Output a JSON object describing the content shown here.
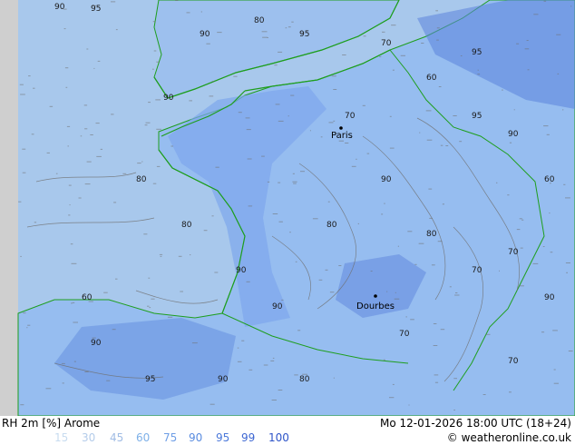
{
  "map": {
    "land_color": "#96bdf0",
    "sea_color": "#a8c8ec",
    "coast_color": "#1e9e1e",
    "contour_color": "#6f6f6f",
    "high_rh_color": "#5b84dc",
    "very_high_rh_color": "#3f6cd6",
    "cities": [
      {
        "name": "Paris"
      },
      {
        "name": "Dourbes"
      }
    ],
    "contour_labels": [
      "90",
      "95",
      "80",
      "70",
      "60",
      "90",
      "95",
      "90",
      "80",
      "70",
      "90",
      "95",
      "60",
      "80",
      "70",
      "90",
      "90",
      "95",
      "80",
      "70",
      "90",
      "60",
      "70",
      "80",
      "90",
      "95",
      "90",
      "80",
      "70",
      "90"
    ]
  },
  "footer": {
    "title": "RH 2m [%] Arome",
    "datetime": "Mo 12-01-2026 18:00 UTC (18+24)",
    "credit": "© weatheronline.co.uk",
    "scale": [
      {
        "label": "15",
        "color": "#c8dcf0"
      },
      {
        "label": "30",
        "color": "#b4ccea"
      },
      {
        "label": "45",
        "color": "#a0bce4"
      },
      {
        "label": "60",
        "color": "#7eb0e8"
      },
      {
        "label": "75",
        "color": "#6e9ee6"
      },
      {
        "label": "90",
        "color": "#5a8ce0"
      },
      {
        "label": "95",
        "color": "#4a78da"
      },
      {
        "label": "99",
        "color": "#3c66d2"
      },
      {
        "label": "100",
        "color": "#2e54c8"
      }
    ]
  }
}
